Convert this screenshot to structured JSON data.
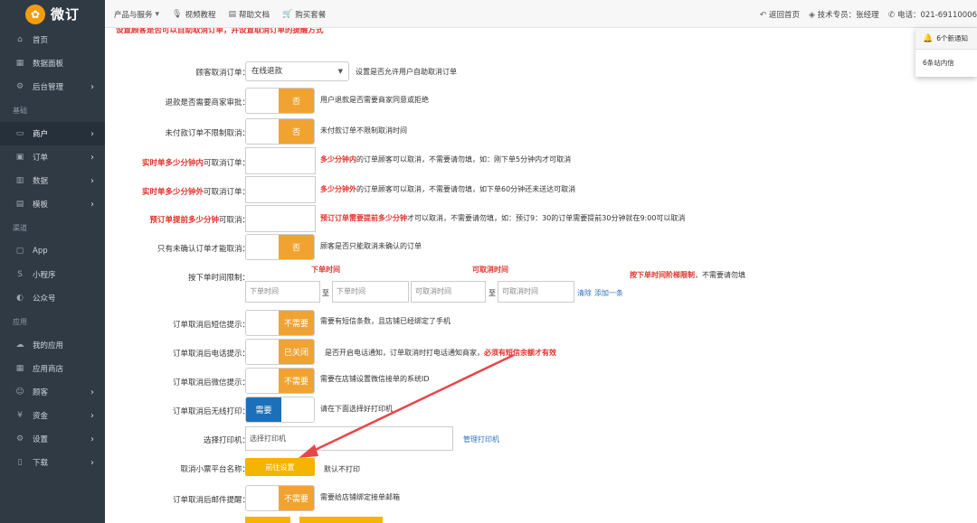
{
  "brand": {
    "logo_text": "微订",
    "logo_icon": "bird-logo-icon"
  },
  "topnav": {
    "items": [
      {
        "label": "产品与服务",
        "icon": "chevron-down-icon"
      },
      {
        "label": "视频教程",
        "icon": "microphone-icon"
      },
      {
        "label": "帮助文档",
        "icon": "document-icon"
      },
      {
        "label": "购买套餐",
        "icon": "cart-icon"
      }
    ],
    "right": {
      "back_home": "返回首页",
      "tech_support": "技术专员：张经理",
      "phone": "电话：021-69110006"
    }
  },
  "notification": {
    "new_notice": "6个新通知",
    "inbox": "6条站内信"
  },
  "sidebar": {
    "items": [
      {
        "label": "首页",
        "icon": "dashboard-icon"
      },
      {
        "label": "数据面板",
        "icon": "panel-icon"
      },
      {
        "label": "后台管理",
        "icon": "gears-icon",
        "chevron": "›"
      },
      {
        "section": "基础"
      },
      {
        "label": "商户",
        "icon": "laptop-icon",
        "chevron": "›",
        "active": true
      },
      {
        "label": "订单",
        "icon": "order-icon",
        "chevron": "›"
      },
      {
        "label": "数据",
        "icon": "chart-icon",
        "chevron": "›"
      },
      {
        "label": "模板",
        "icon": "template-icon",
        "chevron": "›"
      },
      {
        "section": "渠道"
      },
      {
        "label": "App",
        "icon": "app-icon"
      },
      {
        "label": "小程序",
        "icon": "miniprogram-icon"
      },
      {
        "label": "公众号",
        "icon": "wechat-icon"
      },
      {
        "section": "应用"
      },
      {
        "label": "我的应用",
        "icon": "cloud-icon"
      },
      {
        "label": "应用商店",
        "icon": "store-icon"
      },
      {
        "label": "顾客",
        "icon": "users-icon",
        "chevron": "›"
      },
      {
        "label": "资金",
        "icon": "money-icon",
        "chevron": "›"
      },
      {
        "label": "设置",
        "icon": "gear-icon",
        "chevron": "›"
      },
      {
        "label": "下载",
        "icon": "download-icon",
        "chevron": "›"
      }
    ]
  },
  "main": {
    "top_notice": "设置顾客是否可以自助取消订单，并设置取消订单的提醒方式",
    "customer_cancel": {
      "label": "顾客取消订单：",
      "value": "在线退款",
      "desc": "设置是否允许用户自助取消订单"
    },
    "refund_review": {
      "label": "退款是否需要商家审批：",
      "state": "否",
      "desc": "用户退款是否需要商家同意或拒绝"
    },
    "unpaid_cancel": {
      "label": "未付款订单不限制取消：",
      "state": "否",
      "desc": "未付款订单不限制取消时间"
    },
    "realtime_within": {
      "label_red": "实时单多少分钟内",
      "label_rest": "可取消订单：",
      "desc_red": "多少分钟内",
      "desc_rest": "的订单顾客可以取消，不需要请勿填，如：刚下单5分钟内才可取消"
    },
    "realtime_after": {
      "label_red": "实时单多少分钟外",
      "label_rest": "可取消订单：",
      "desc_red": "多少分钟外",
      "desc_rest": "的订单顾客可以取消，不需要请勿填，如下单60分钟还未送达可取消"
    },
    "preorder": {
      "label_red": "预订单提前多少分钟",
      "label_rest": "可取消：",
      "desc_red": "预订订单需要提前多少分钟",
      "desc_rest": "才可以取消，不需要请勿填，如：预订9：30的订单需要提前30分钟就在9:00可以取消"
    },
    "confirm_only": {
      "label": "只有未确认订单才能取消：",
      "state": "否",
      "desc": "顾客是否只能取消未确认的订单"
    },
    "time_limit": {
      "label": "按下单时间限制：",
      "header_order_time": "下单时间",
      "header_cancel_time": "可取消时间",
      "note_red": "按下单时间阶梯限制",
      "note_rest": "，不需要请勿填",
      "placeholder_order": "下单时间",
      "placeholder_cancel": "可取消时间",
      "to": "至",
      "clear": "清除",
      "add": "添加一条"
    },
    "sms_notice": {
      "label": "订单取消后短信提示：",
      "state": "不需要",
      "desc": "需要有短信条数，且店铺已经绑定了手机"
    },
    "phone_notice": {
      "label": "订单取消后电话提示：",
      "state": "已关闭",
      "desc": "是否开启电话通知，订单取消时打电话通知商家，",
      "desc_red": "必须有短信余额才有效"
    },
    "wechat_notice": {
      "label": "订单取消后微信提示：",
      "state": "不需要",
      "desc": "需要在店铺设置微信接单的系统ID"
    },
    "wireless_print": {
      "label": "订单取消后无线打印：",
      "state": "需要",
      "desc": "请在下面选择好打印机"
    },
    "printer": {
      "label": "选择打印机：",
      "placeholder": "选择打印机",
      "manage": "管理打印机"
    },
    "ticket_platform": {
      "label": "取消小票平台名称：",
      "button": "前往设置",
      "desc": "默认不打印"
    },
    "mail_notice": {
      "label": "订单取消后邮件提醒：",
      "state": "不需要",
      "desc": "需要给店铺绑定接单邮箱"
    }
  },
  "colors": {
    "accent_orange": "#f0a331",
    "button_yellow": "#f5b400",
    "toggle_blue": "#1d6fb8",
    "alert_red": "#e0322b",
    "sidebar_bg": "#2f3a45"
  }
}
